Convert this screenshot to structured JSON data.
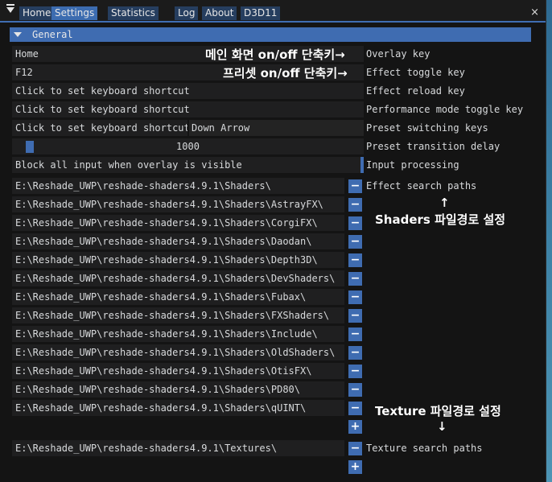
{
  "tabs": [
    "Home",
    "Settings",
    "Statistics",
    "Log",
    "About",
    "D3D11"
  ],
  "close_glyph": "×",
  "section_title": "General",
  "overlay_key": {
    "value": "Home",
    "label": "Overlay key",
    "note": "메인 화면 on/off 단축키→"
  },
  "effect_toggle_key": {
    "value": "F12",
    "label": "Effect toggle key",
    "note": "프리셋 on/off 단축키→"
  },
  "effect_reload_key": {
    "value": "Click to set keyboard shortcut",
    "label": "Effect reload key"
  },
  "performance_mode_key": {
    "value": "Click to set keyboard shortcut",
    "label": "Performance mode toggle key"
  },
  "preset_switching": {
    "value": "Click to set keyboard shortcut",
    "second": "Down Arrow",
    "label": "Preset switching keys"
  },
  "preset_delay": {
    "value": "1000",
    "level": 0.03,
    "label": "Preset transition delay"
  },
  "input_processing": {
    "value": "Block all input when overlay is visible",
    "label": "Input processing"
  },
  "effect_search_paths": {
    "label": "Effect search paths",
    "paths": [
      "E:\\Reshade_UWP\\reshade-shaders4.9.1\\Shaders\\",
      "E:\\Reshade_UWP\\reshade-shaders4.9.1\\Shaders\\AstrayFX\\",
      "E:\\Reshade_UWP\\reshade-shaders4.9.1\\Shaders\\CorgiFX\\",
      "E:\\Reshade_UWP\\reshade-shaders4.9.1\\Shaders\\Daodan\\",
      "E:\\Reshade_UWP\\reshade-shaders4.9.1\\Shaders\\Depth3D\\",
      "E:\\Reshade_UWP\\reshade-shaders4.9.1\\Shaders\\DevShaders\\",
      "E:\\Reshade_UWP\\reshade-shaders4.9.1\\Shaders\\Fubax\\",
      "E:\\Reshade_UWP\\reshade-shaders4.9.1\\Shaders\\FXShaders\\",
      "E:\\Reshade_UWP\\reshade-shaders4.9.1\\Shaders\\Include\\",
      "E:\\Reshade_UWP\\reshade-shaders4.9.1\\Shaders\\OldShaders\\",
      "E:\\Reshade_UWP\\reshade-shaders4.9.1\\Shaders\\OtisFX\\",
      "E:\\Reshade_UWP\\reshade-shaders4.9.1\\Shaders\\PD80\\",
      "E:\\Reshade_UWP\\reshade-shaders4.9.1\\Shaders\\qUINT\\"
    ],
    "note_arrow": "↑",
    "note": "Shaders 파일경로 설정"
  },
  "texture_search_paths": {
    "label": "Texture search paths",
    "paths": [
      "E:\\Reshade_UWP\\reshade-shaders4.9.1\\Textures\\"
    ],
    "note": "Texture 파일경로 설정",
    "note_arrow": "↓"
  },
  "buttons": {
    "remove": "−",
    "add": "+"
  },
  "colors": {
    "accent": "#3f6cb1",
    "tab_inactive": "#263e5f",
    "background": "#141414",
    "field": "#1f1f20"
  },
  "icons": {
    "collapse": "collapse-triangle-icon",
    "dropdown": "chevron-down-icon"
  }
}
